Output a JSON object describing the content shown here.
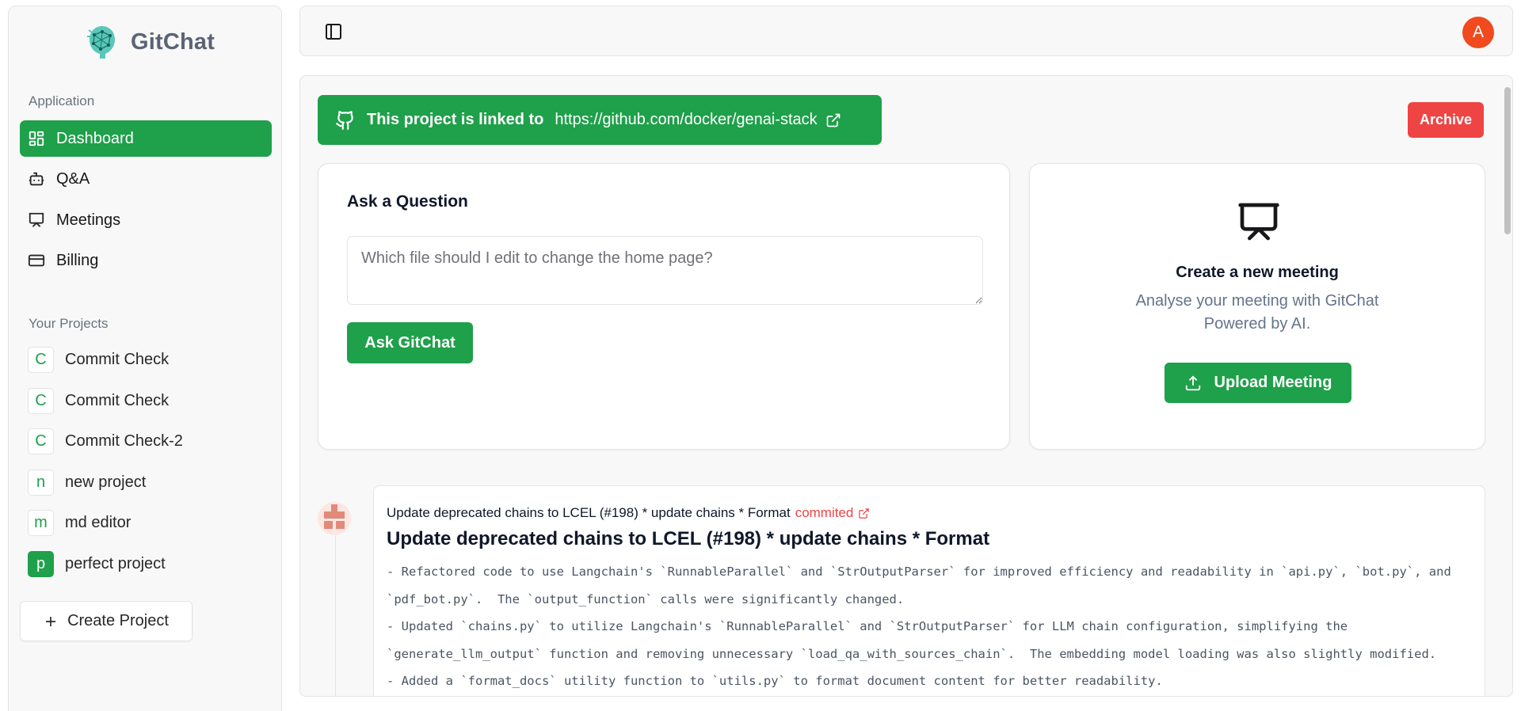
{
  "sidebar": {
    "brand": "GitChat",
    "application_label": "Application",
    "nav": [
      {
        "label": "Dashboard",
        "icon": "dashboard-icon"
      },
      {
        "label": "Q&A",
        "icon": "bot-icon"
      },
      {
        "label": "Meetings",
        "icon": "presentation-icon"
      },
      {
        "label": "Billing",
        "icon": "credit-card-icon"
      }
    ],
    "projects_label": "Your Projects",
    "projects": [
      {
        "initial": "C",
        "name": "Commit Check"
      },
      {
        "initial": "C",
        "name": "Commit Check"
      },
      {
        "initial": "C",
        "name": "Commit Check-2"
      },
      {
        "initial": "n",
        "name": "new project"
      },
      {
        "initial": "m",
        "name": "md editor"
      },
      {
        "initial": "p",
        "name": "perfect project"
      }
    ],
    "create_project": "Create Project"
  },
  "topbar": {
    "avatar_initial": "A"
  },
  "main": {
    "link_banner": {
      "prefix": "This project is linked to",
      "url": "https://github.com/docker/genai-stack"
    },
    "archive": "Archive",
    "ask": {
      "title": "Ask a Question",
      "placeholder": "Which file should I edit to change the home page?",
      "button": "Ask GitChat"
    },
    "meeting": {
      "title": "Create a new meeting",
      "subtitle_line1": "Analyse your meeting with GitChat",
      "subtitle_line2": "Powered by AI.",
      "button": "Upload Meeting"
    },
    "commits": [
      {
        "message": "Update deprecated chains to LCEL (#198) * update chains * Format",
        "status": "commited",
        "title": "Update deprecated chains to LCEL (#198) * update chains * Format",
        "summary": "- Refactored code to use Langchain's `RunnableParallel` and `StrOutputParser` for improved efficiency and readability in `api.py`, `bot.py`, and `pdf_bot.py`.  The `output_function` calls were significantly changed.\n- Updated `chains.py` to utilize Langchain's `RunnableParallel` and `StrOutputParser` for LLM chain configuration, simplifying the `generate_llm_output` function and removing unnecessary `load_qa_with_sources_chain`.  The embedding model loading was also slightly modified.\n- Added a `format_docs` utility function to `utils.py` to format document content for better readability."
      }
    ]
  },
  "colors": {
    "accent": "#1fa04a",
    "danger": "#ef4444",
    "avatar": "#f04a1e"
  }
}
